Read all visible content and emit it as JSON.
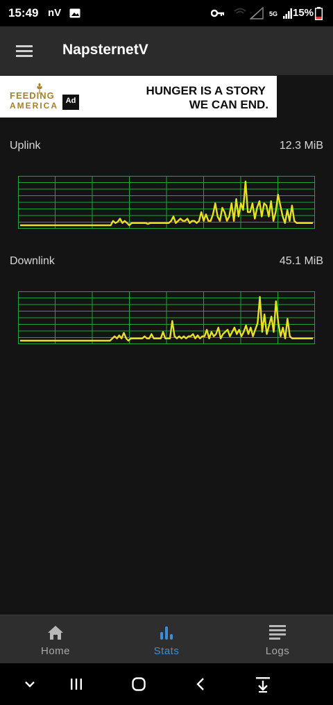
{
  "status_bar": {
    "time": "15:49",
    "carrier": "nV",
    "network": "5G",
    "battery": "15%"
  },
  "app_bar": {
    "title": "NapsternetV"
  },
  "ad": {
    "brand_line1": "FEEDING",
    "brand_line2": "AMERICA",
    "badge": "Ad",
    "headline_line1": "HUNGER IS A STORY",
    "headline_line2": "WE CAN END."
  },
  "stats": {
    "uplink": {
      "label": "Uplink",
      "value": "12.3 MiB",
      "samples": [
        0,
        0,
        0,
        0,
        0,
        0,
        0,
        0,
        0,
        0,
        0,
        0,
        0,
        0,
        0,
        0,
        0,
        0,
        0,
        0,
        0,
        0,
        0,
        0,
        0,
        0,
        0,
        0,
        0,
        0,
        0,
        0,
        0,
        0,
        0,
        0,
        0,
        0,
        0,
        0,
        0.1,
        0.05,
        0.08,
        0.15,
        0.05,
        0.1,
        0.05,
        0,
        0.05,
        0.05,
        0.05,
        0.05,
        0.05,
        0.05,
        0.05,
        0.03,
        0.05,
        0.05,
        0.05,
        0.05,
        0.05,
        0.05,
        0.05,
        0.05,
        0.05,
        0.1,
        0.2,
        0.05,
        0.1,
        0.15,
        0.1,
        0.1,
        0.15,
        0.05,
        0.1,
        0.1,
        0.05,
        0.1,
        0.3,
        0.1,
        0.25,
        0.1,
        0.1,
        0.25,
        0.5,
        0.2,
        0.1,
        0.4,
        0.3,
        0.1,
        0.2,
        0.5,
        0.1,
        0.6,
        0.2,
        0.5,
        0.35,
        1.0,
        0.3,
        0.3,
        0.5,
        0.15,
        0.4,
        0.55,
        0.2,
        0.5,
        0.45,
        0.2,
        0.55,
        0.1,
        0.3,
        0.7,
        0.45,
        0.2,
        0.05,
        0.35,
        0.1,
        0.45,
        0.1,
        0.05,
        0.05,
        0.05,
        0.05,
        0.05,
        0.05,
        0.05,
        0.05
      ]
    },
    "downlink": {
      "label": "Downlink",
      "value": "45.1 MiB",
      "samples": [
        0,
        0,
        0,
        0,
        0,
        0,
        0,
        0,
        0,
        0,
        0,
        0,
        0,
        0,
        0,
        0,
        0,
        0,
        0,
        0,
        0,
        0,
        0,
        0,
        0,
        0,
        0,
        0,
        0,
        0,
        0,
        0,
        0,
        0,
        0,
        0,
        0,
        0,
        0,
        0,
        0.05,
        0.1,
        0.05,
        0.12,
        0.05,
        0.18,
        0.05,
        0,
        0.05,
        0.05,
        0.05,
        0.05,
        0.05,
        0.05,
        0.1,
        0.05,
        0.05,
        0.15,
        0.05,
        0.05,
        0.05,
        0.05,
        0.2,
        0.05,
        0.05,
        0.05,
        0.45,
        0.1,
        0.05,
        0.1,
        0.05,
        0.1,
        0.05,
        0.1,
        0.1,
        0.15,
        0.05,
        0.12,
        0.05,
        0.1,
        0.1,
        0.25,
        0.05,
        0.2,
        0.1,
        0.15,
        0.3,
        0.05,
        0.15,
        0.2,
        0.25,
        0.1,
        0.2,
        0.3,
        0.15,
        0.25,
        0.1,
        0.2,
        0.35,
        0.15,
        0.3,
        0.1,
        0.25,
        0.4,
        1.0,
        0.2,
        0.6,
        0.15,
        0.35,
        0.55,
        0.2,
        0.9,
        0.4,
        0.1,
        0.3,
        0.05,
        0.5,
        0.1,
        0.05,
        0.05,
        0.05,
        0.05,
        0.05,
        0.05,
        0.05,
        0.05,
        0.05,
        0.05
      ]
    }
  },
  "bottom_nav": {
    "home": "Home",
    "stats": "Stats",
    "logs": "Logs",
    "active": "stats",
    "active_color": "#3d8ed8"
  },
  "colors": {
    "graph_line": "#e8e020",
    "graph_grid": "#1ea53a",
    "background": "#141414",
    "app_bar": "#2b2b2b"
  }
}
